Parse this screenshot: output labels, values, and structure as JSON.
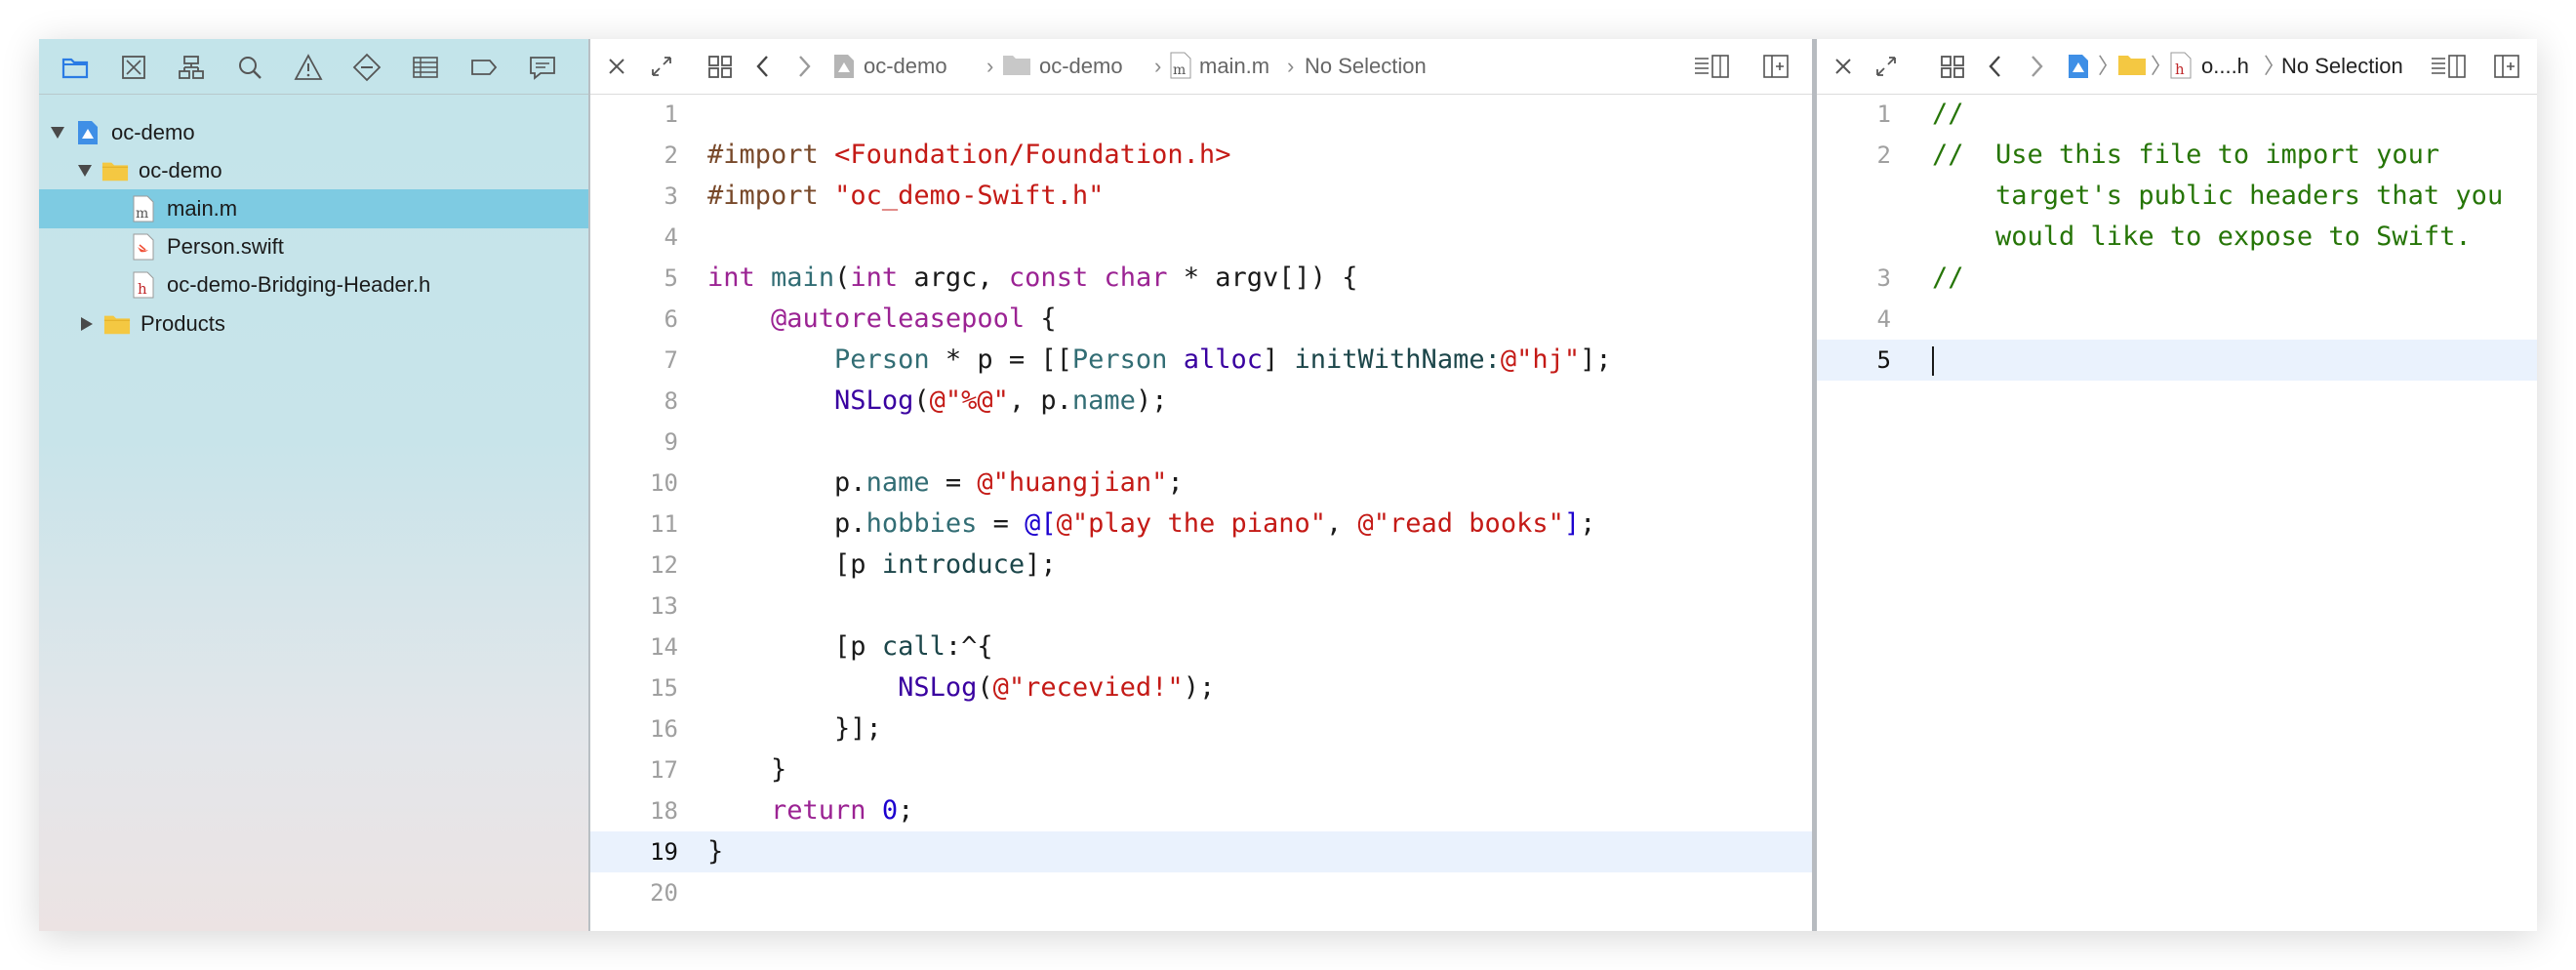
{
  "navigator": {
    "toolbar_icons": [
      "folder-icon",
      "source-control-icon",
      "symbol-hierarchy-icon",
      "search-icon",
      "warning-icon",
      "test-diamond-icon",
      "debug-list-icon",
      "breakpoint-icon",
      "report-bubble-icon"
    ],
    "project": "oc-demo",
    "group": "oc-demo",
    "files": [
      "main.m",
      "Person.swift",
      "oc-demo-Bridging-Header.h"
    ],
    "selected_file": "main.m",
    "products": "Products",
    "colors": {
      "selection": "#7ecbe2",
      "folder": "#f4c842",
      "project_icon": "#3f8fe6"
    }
  },
  "editor_left": {
    "breadcrumbs": [
      "oc-demo",
      "oc-demo",
      "main.m",
      "No Selection"
    ],
    "current_line": "19"
  },
  "editor_right": {
    "breadcrumb_short": "o....h",
    "breadcrumb_end": "No Selection",
    "current_line": "5"
  },
  "code_left": {
    "nums": [
      "1",
      "2",
      "3",
      "4",
      "5",
      "6",
      "7",
      "8",
      "9",
      "10",
      "11",
      "12",
      "13",
      "14",
      "15",
      "16",
      "17",
      "18",
      "19",
      "20"
    ],
    "import1": "#import",
    "foundation": "<Foundation/Foundation.h>",
    "import2": "#import",
    "swift_header": "\"oc_demo-Swift.h\"",
    "int_kw": "int",
    "main_fn": "main",
    "paren_open": "(",
    "int_kw2": "int",
    "argc": " argc, ",
    "const_kw": "const",
    "sp1": " ",
    "char_kw": "char",
    "argv": " * argv[]) {",
    "autorelease": "@autoreleasepool",
    "brace_open": " {",
    "person_cls": "Person",
    "p_decl": " * p = [[",
    "person_cls2": "Person",
    "sp2": " ",
    "alloc": "alloc",
    "init_pre": "] ",
    "init_sel": "initWithName:",
    "hj": "@\"hj\"",
    "close_msg": "];",
    "nslog": "NSLog",
    "nslog_open": "(",
    "fmt": "@\"%@\"",
    "p_comma": ", p.",
    "name_prop": "name",
    "close_paren": ");",
    "p_dot": "p.",
    "name_prop2": "name",
    "assign": " = ",
    "huangjian": "@\"huangjian\"",
    "semi": ";",
    "p_dot2": "p.",
    "hobbies": "hobbies",
    "assign2": " = ",
    "at_bracket": "@[",
    "piano": "@\"play the piano\"",
    "comma": ", ",
    "books": "@\"read books\"",
    "bracket_close": "]",
    "semi2": ";",
    "introduce_pre": "[p ",
    "introduce": "introduce",
    "introduce_post": "];",
    "call_pre": "[p ",
    "call": "call",
    "call_post": ":^{",
    "nslog2": "NSLog",
    "nslog2_open": "(",
    "recevied": "@\"recevied!\"",
    "nslog2_close": ");",
    "block_close": "}];",
    "pool_close": "}",
    "return_kw": "return",
    "zero": "0",
    "return_semi": ";",
    "main_close": "}"
  },
  "code_right": {
    "nums": [
      "1",
      "2",
      "",
      "",
      "3",
      "4",
      "5"
    ],
    "lines": [
      "//",
      "//  Use this file to import your",
      "    target's public headers that you",
      "    would like to expose to Swift.",
      "//",
      "",
      ""
    ]
  }
}
